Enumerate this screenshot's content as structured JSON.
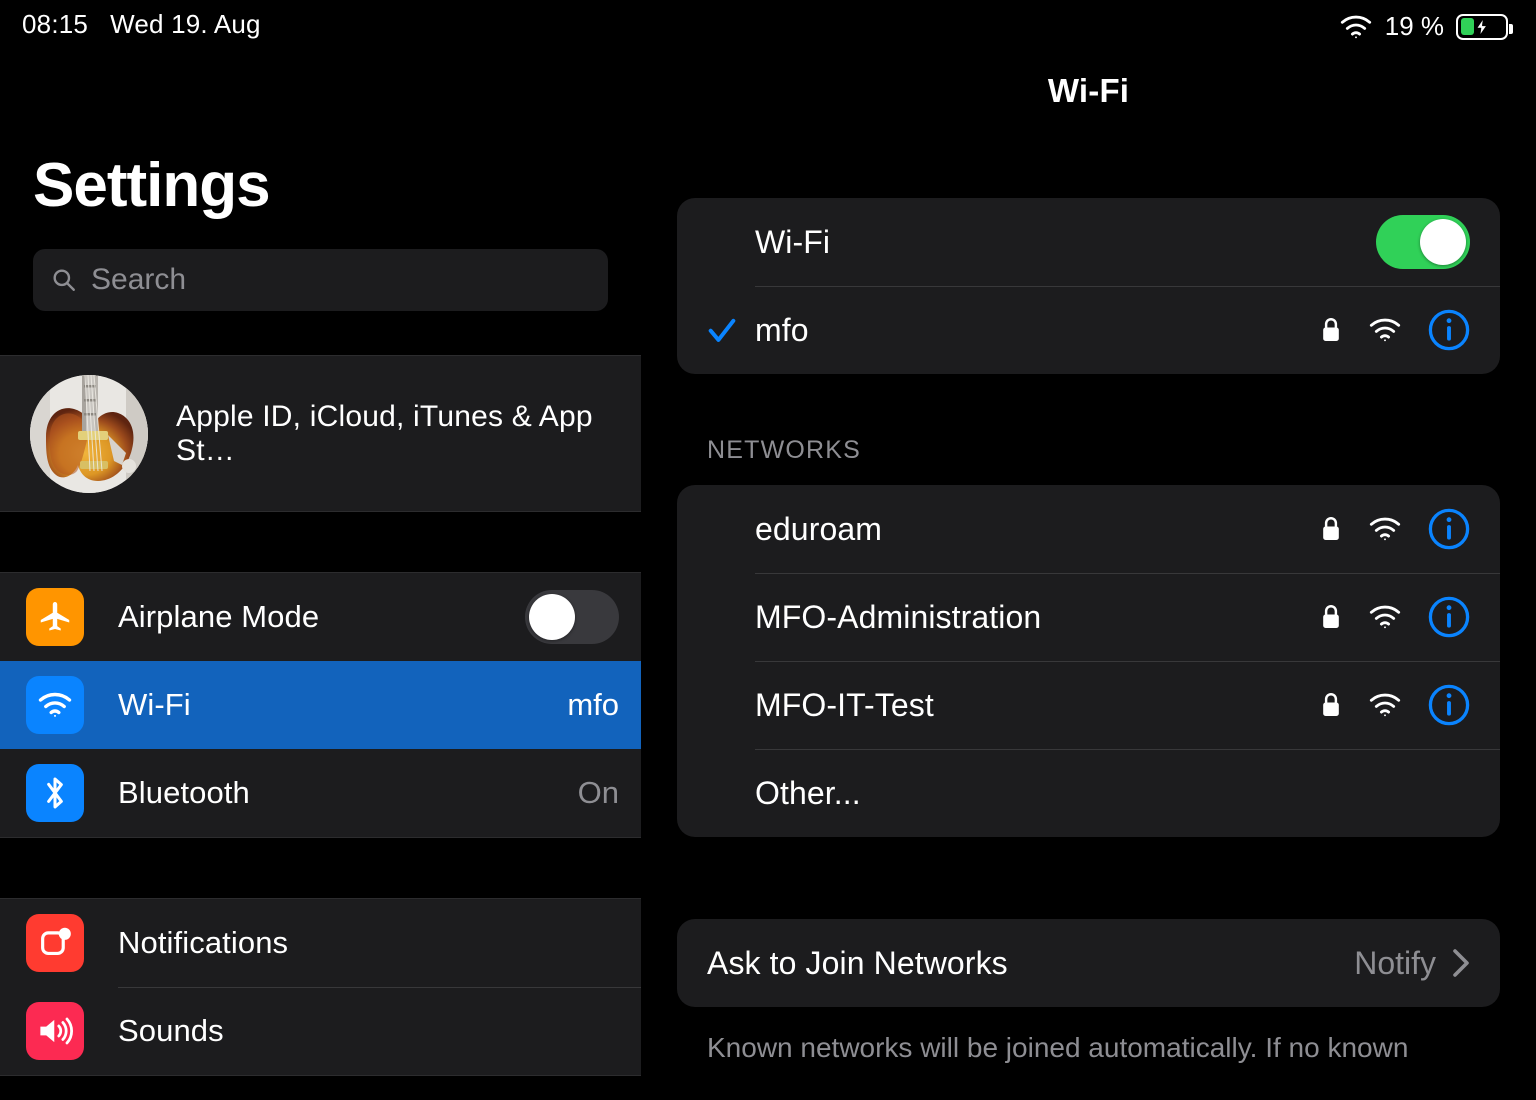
{
  "status_bar": {
    "time": "08:15",
    "date": "Wed 19. Aug",
    "battery_percent": "19 %",
    "wifi_icon": "wifi-icon",
    "battery_icon": "battery-charging-icon"
  },
  "sidebar": {
    "title": "Settings",
    "search": {
      "placeholder": "Search",
      "value": "",
      "icon": "search-icon"
    },
    "profile": {
      "label": "Apple ID, iCloud, iTunes & App St…",
      "avatar": "guitar-photo-avatar"
    },
    "groups": [
      {
        "items": [
          {
            "label": "Airplane Mode",
            "icon": "airplane-icon",
            "control": "toggle",
            "toggle_on": false,
            "value": ""
          },
          {
            "label": "Wi-Fi",
            "icon": "wifi-icon",
            "control": "value",
            "value": "mfo",
            "selected": true
          },
          {
            "label": "Bluetooth",
            "icon": "bluetooth-icon",
            "control": "value",
            "value": "On",
            "selected": false
          }
        ]
      },
      {
        "items": [
          {
            "label": "Notifications",
            "icon": "notifications-icon",
            "control": "none",
            "value": ""
          },
          {
            "label": "Sounds",
            "icon": "sounds-icon",
            "control": "none",
            "value": ""
          }
        ]
      }
    ]
  },
  "detail": {
    "title": "Wi-Fi",
    "wifi_toggle": {
      "label": "Wi-Fi",
      "on": true
    },
    "connected_network": {
      "ssid": "mfo",
      "connected": true,
      "secured": true,
      "signal": 3,
      "check_icon": "checkmark-icon",
      "lock_icon": "lock-icon",
      "signal_icon": "wifi-signal-icon",
      "info_icon": "info-circle-icon"
    },
    "networks_header": "NETWORKS",
    "networks": [
      {
        "ssid": "eduroam",
        "secured": true,
        "signal": 3,
        "has_info": true
      },
      {
        "ssid": "MFO-Administration",
        "secured": true,
        "signal": 3,
        "has_info": true
      },
      {
        "ssid": "MFO-IT-Test",
        "secured": true,
        "signal": 3,
        "has_info": true
      },
      {
        "ssid": "Other...",
        "secured": false,
        "signal": 0,
        "has_info": false
      }
    ],
    "ask_to_join": {
      "label": "Ask to Join Networks",
      "value": "Notify",
      "chevron_icon": "chevron-right-icon"
    },
    "footer_note": "Known networks will be joined automatically. If no known"
  },
  "colors": {
    "accent_blue": "#0a84ff",
    "selected_row": "#1263bc",
    "toggle_on_green": "#30d158",
    "toggle_off": "#39393d",
    "card_bg": "#1c1c1e",
    "secondary_text": "#8e8e93",
    "airplane_orange": "#ff9500",
    "notifications_red": "#ff3b30",
    "sounds_pink": "#fc2a52"
  }
}
